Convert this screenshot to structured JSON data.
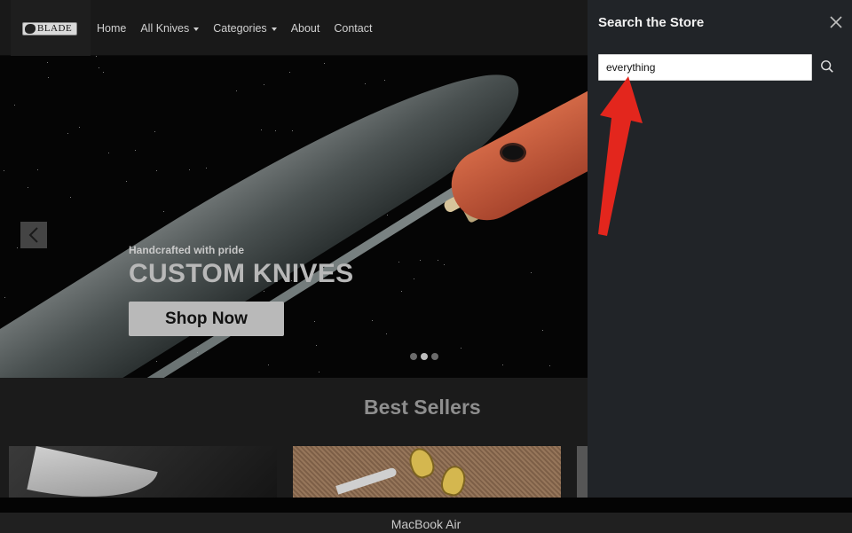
{
  "header": {
    "logo_text": "BLADE",
    "nav": [
      {
        "label": "Home",
        "has_dropdown": false
      },
      {
        "label": "All Knives",
        "has_dropdown": true
      },
      {
        "label": "Categories",
        "has_dropdown": true
      },
      {
        "label": "About",
        "has_dropdown": false
      },
      {
        "label": "Contact",
        "has_dropdown": false
      }
    ]
  },
  "hero": {
    "kicker": "Handcrafted with pride",
    "title": "CUSTOM KNIVES",
    "cta_label": "Shop Now",
    "slide_count": 3,
    "active_slide": 2
  },
  "best_sellers": {
    "title": "Best Sellers"
  },
  "search_panel": {
    "title": "Search the Store",
    "input_value": "everything"
  },
  "annotation": {
    "color": "#e3261d"
  },
  "device": {
    "label": "MacBook Air"
  },
  "colors": {
    "panel_bg": "#212428",
    "header_bg": "#191919",
    "handle": "#c85a3c"
  }
}
